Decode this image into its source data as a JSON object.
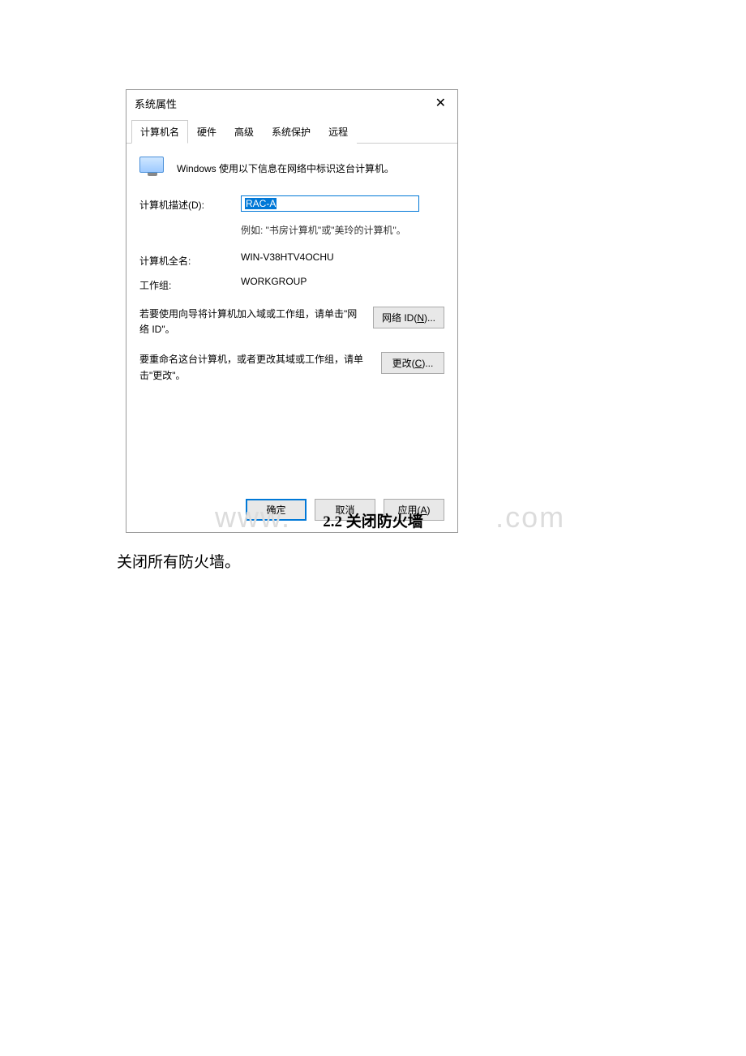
{
  "dialog": {
    "title": "系统属性",
    "tabs": [
      "计算机名",
      "硬件",
      "高级",
      "系统保护",
      "远程"
    ],
    "active_tab_index": 0,
    "intro": "Windows 使用以下信息在网络中标识这台计算机。",
    "fields": {
      "description_label": "计算机描述(D):",
      "description_value": "RAC-A",
      "description_hint": "例如: \"书房计算机\"或\"美玲的计算机\"。",
      "fullname_label": "计算机全名:",
      "fullname_value": "WIN-V38HTV4OCHU",
      "workgroup_label": "工作组:",
      "workgroup_value": "WORKGROUP"
    },
    "wizard_text": "若要使用向导将计算机加入域或工作组，请单击\"网络 ID\"。",
    "network_id_button": "网络 ID(N)...",
    "change_text": "要重命名这台计算机，或者更改其域或工作组，请单击\"更改\"。",
    "change_button": "更改(C)...",
    "ok_button": "确定",
    "cancel_button": "取消",
    "apply_button": "应用(A)"
  },
  "watermark_left": "www.",
  "watermark_right": ".com",
  "section_heading": "2.2 关闭防火墙",
  "body_text": "关闭所有防火墙。"
}
